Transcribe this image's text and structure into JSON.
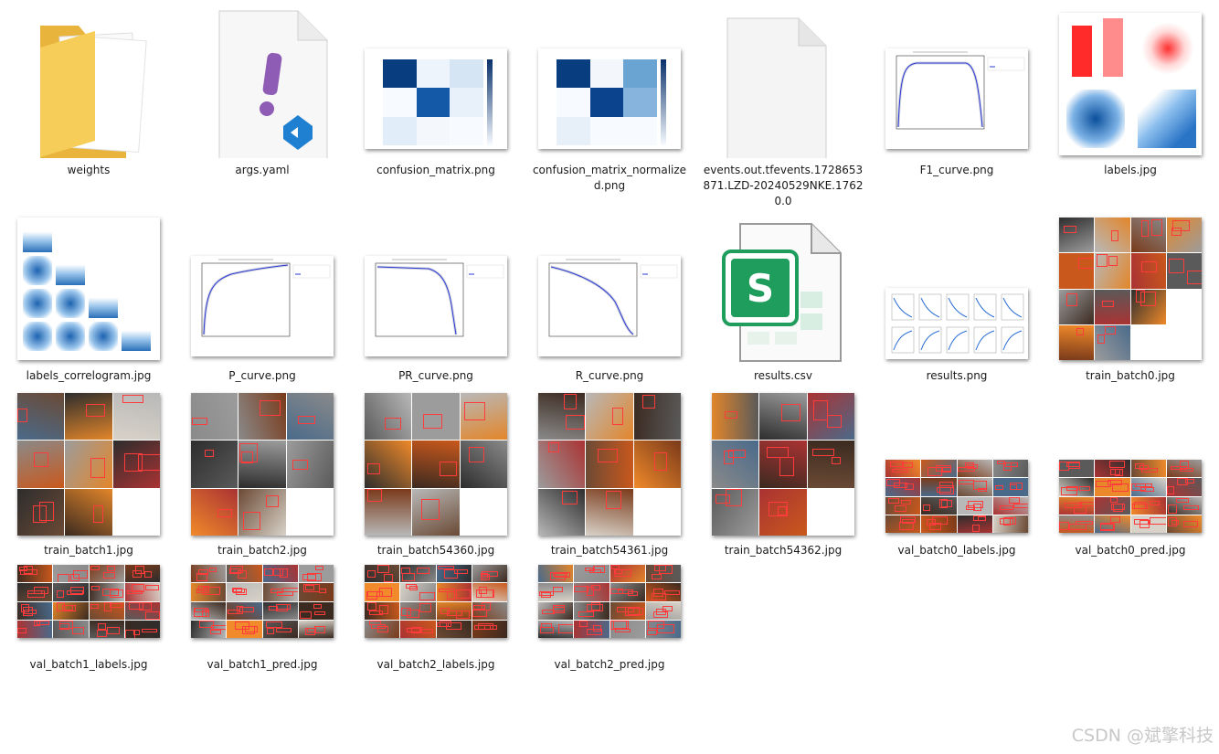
{
  "window": {
    "title": ""
  },
  "files": [
    {
      "name": "weights",
      "type": "folder"
    },
    {
      "name": "args.yaml",
      "type": "yaml"
    },
    {
      "name": "confusion_matrix.png",
      "type": "confusion"
    },
    {
      "name": "confusion_matrix_normalized.png",
      "type": "confusion-norm"
    },
    {
      "name": "events.out.tfevents.1728653871.LZD-20240529NKE.17620.0",
      "type": "blank-doc"
    },
    {
      "name": "F1_curve.png",
      "type": "curve-f1"
    },
    {
      "name": "labels.jpg",
      "type": "labels"
    },
    {
      "name": "labels_correlogram.jpg",
      "type": "correlogram"
    },
    {
      "name": "P_curve.png",
      "type": "curve-p"
    },
    {
      "name": "PR_curve.png",
      "type": "curve-pr"
    },
    {
      "name": "R_curve.png",
      "type": "curve-r"
    },
    {
      "name": "results.csv",
      "type": "csv"
    },
    {
      "name": "results.png",
      "type": "results"
    },
    {
      "name": "train_batch0.jpg",
      "type": "batch-tall"
    },
    {
      "name": "train_batch1.jpg",
      "type": "batch"
    },
    {
      "name": "train_batch2.jpg",
      "type": "batch"
    },
    {
      "name": "train_batch54360.jpg",
      "type": "batch"
    },
    {
      "name": "train_batch54361.jpg",
      "type": "batch"
    },
    {
      "name": "train_batch54362.jpg",
      "type": "batch"
    },
    {
      "name": "val_batch0_labels.jpg",
      "type": "val"
    },
    {
      "name": "val_batch0_pred.jpg",
      "type": "val"
    },
    {
      "name": "val_batch1_labels.jpg",
      "type": "val"
    },
    {
      "name": "val_batch1_pred.jpg",
      "type": "val"
    },
    {
      "name": "val_batch2_labels.jpg",
      "type": "val"
    },
    {
      "name": "val_batch2_pred.jpg",
      "type": "val"
    }
  ],
  "watermark": "CSDN @斌擎科技",
  "colors": {
    "folder": "#f3c64e",
    "blues": "#08306b",
    "curve": "#2a3bd6",
    "csv": "#1f9d5c",
    "bbox": "#ff3b3b"
  }
}
